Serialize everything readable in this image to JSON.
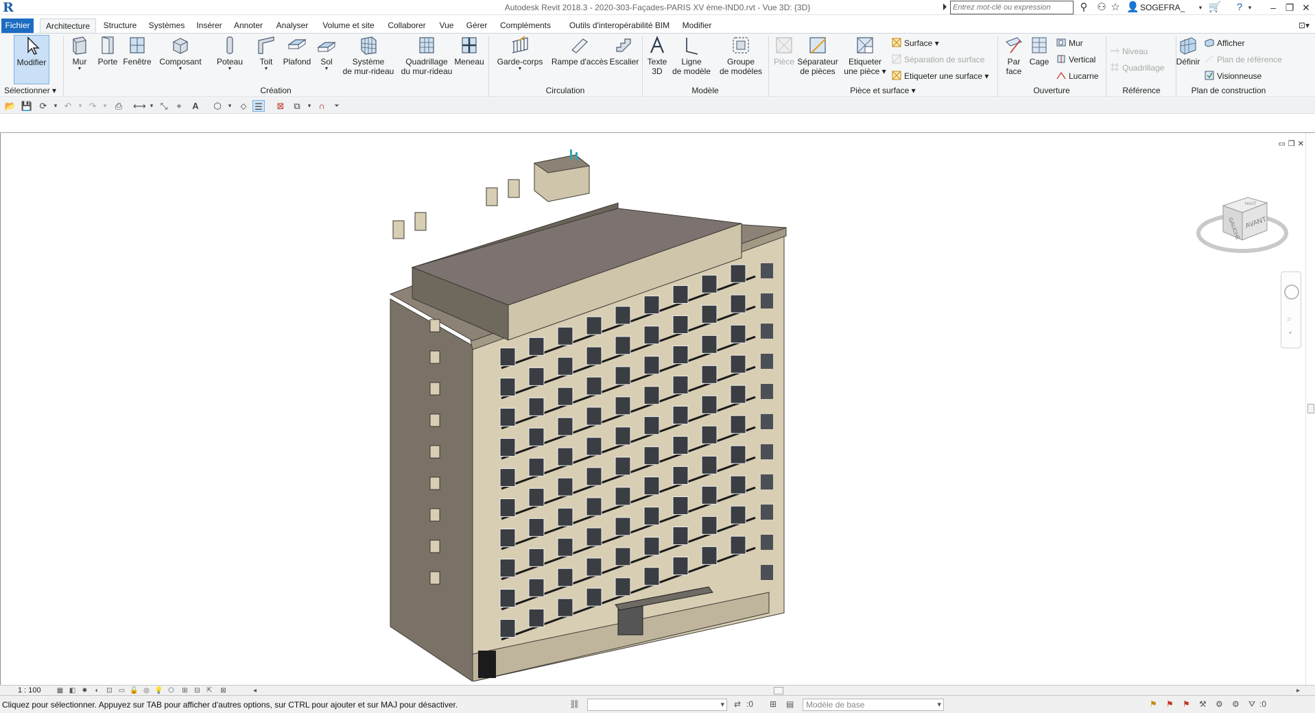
{
  "titlebar": {
    "logo": "R",
    "window_title": "Autodesk Revit 2018.3 -    2020-303-Façades-PARIS  XV ème-IND0.rvt - Vue 3D: {3D}",
    "search_placeholder": "Entrez mot-clé ou expression",
    "user": "SOGEFRA_"
  },
  "tabs": [
    {
      "label": "Fichier",
      "active": false
    },
    {
      "label": "Architecture",
      "active": true
    },
    {
      "label": "Structure"
    },
    {
      "label": "Systèmes"
    },
    {
      "label": "Insérer"
    },
    {
      "label": "Annoter"
    },
    {
      "label": "Analyser"
    },
    {
      "label": "Volume et site"
    },
    {
      "label": "Collaborer"
    },
    {
      "label": "Vue"
    },
    {
      "label": "Gérer"
    },
    {
      "label": "Compléments"
    },
    {
      "label": "Outils d'interopérabilité BIM"
    },
    {
      "label": "Modifier"
    }
  ],
  "ribbon": {
    "select": {
      "modify": "Modifier",
      "panel": "Sélectionner"
    },
    "creation": {
      "panel": "Création",
      "wall": "Mur",
      "door": "Porte",
      "window": "Fenêtre",
      "component": "Composant",
      "column": "Poteau",
      "roof": "Toit",
      "ceiling": "Plafond",
      "floor": "Sol",
      "curtain_system_1": "Système",
      "curtain_system_2": "de mur-rideau",
      "curtain_grid_1": "Quadrillage",
      "curtain_grid_2": "du mur-rideau",
      "mullion": "Meneau"
    },
    "circulation": {
      "panel": "Circulation",
      "railing": "Garde-corps",
      "ramp": "Rampe d'accès",
      "stair": "Escalier"
    },
    "model": {
      "panel": "Modèle",
      "text_1": "Texte",
      "text_2": "3D",
      "line_1": "Ligne",
      "line_2": "de modèle",
      "group_1": "Groupe",
      "group_2": "de modèles"
    },
    "room": {
      "panel": "Pièce et surface",
      "room": "Pièce",
      "separator_1": "Séparateur",
      "separator_2": "de pièces",
      "tag_1": "Etiqueter",
      "tag_2": "une pièce",
      "area": "Surface",
      "area_separation": "Séparation  de surface",
      "tag_area": "Etiqueter  une surface"
    },
    "opening": {
      "panel": "Ouverture",
      "by_face_1": "Par",
      "by_face_2": "face",
      "shaft": "Cage",
      "wall": "Mur",
      "vertical": "Vertical",
      "dormer": "Lucarne"
    },
    "datum": {
      "panel": "Référence",
      "level": "Niveau",
      "grid": "Quadrillage"
    },
    "workplane": {
      "panel": "Plan de construction",
      "set": "Définir",
      "show": "Afficher",
      "ref_plane": "Plan de référence",
      "viewer": "Visionneuse"
    }
  },
  "viewcube": {
    "top": "HAUT",
    "left": "GAUCHE",
    "front": "AVANT"
  },
  "viewbar": {
    "scale": "1 : 100"
  },
  "statusbar": {
    "text": "Cliquez pour sélectionner. Appuyez sur TAB pour afficher d'autres options, sur CTRL pour ajouter et sur MAJ pour désactiver.",
    "worksets": ":0",
    "model": "Modèle de base",
    "filter": ":0"
  },
  "colors": {
    "file_tab": "#1c6cc0",
    "ribbon_bg": "#f5f6f7",
    "facade": "#d8ceb4",
    "side_wall": "#7a7266",
    "roof": "#7c7370"
  }
}
